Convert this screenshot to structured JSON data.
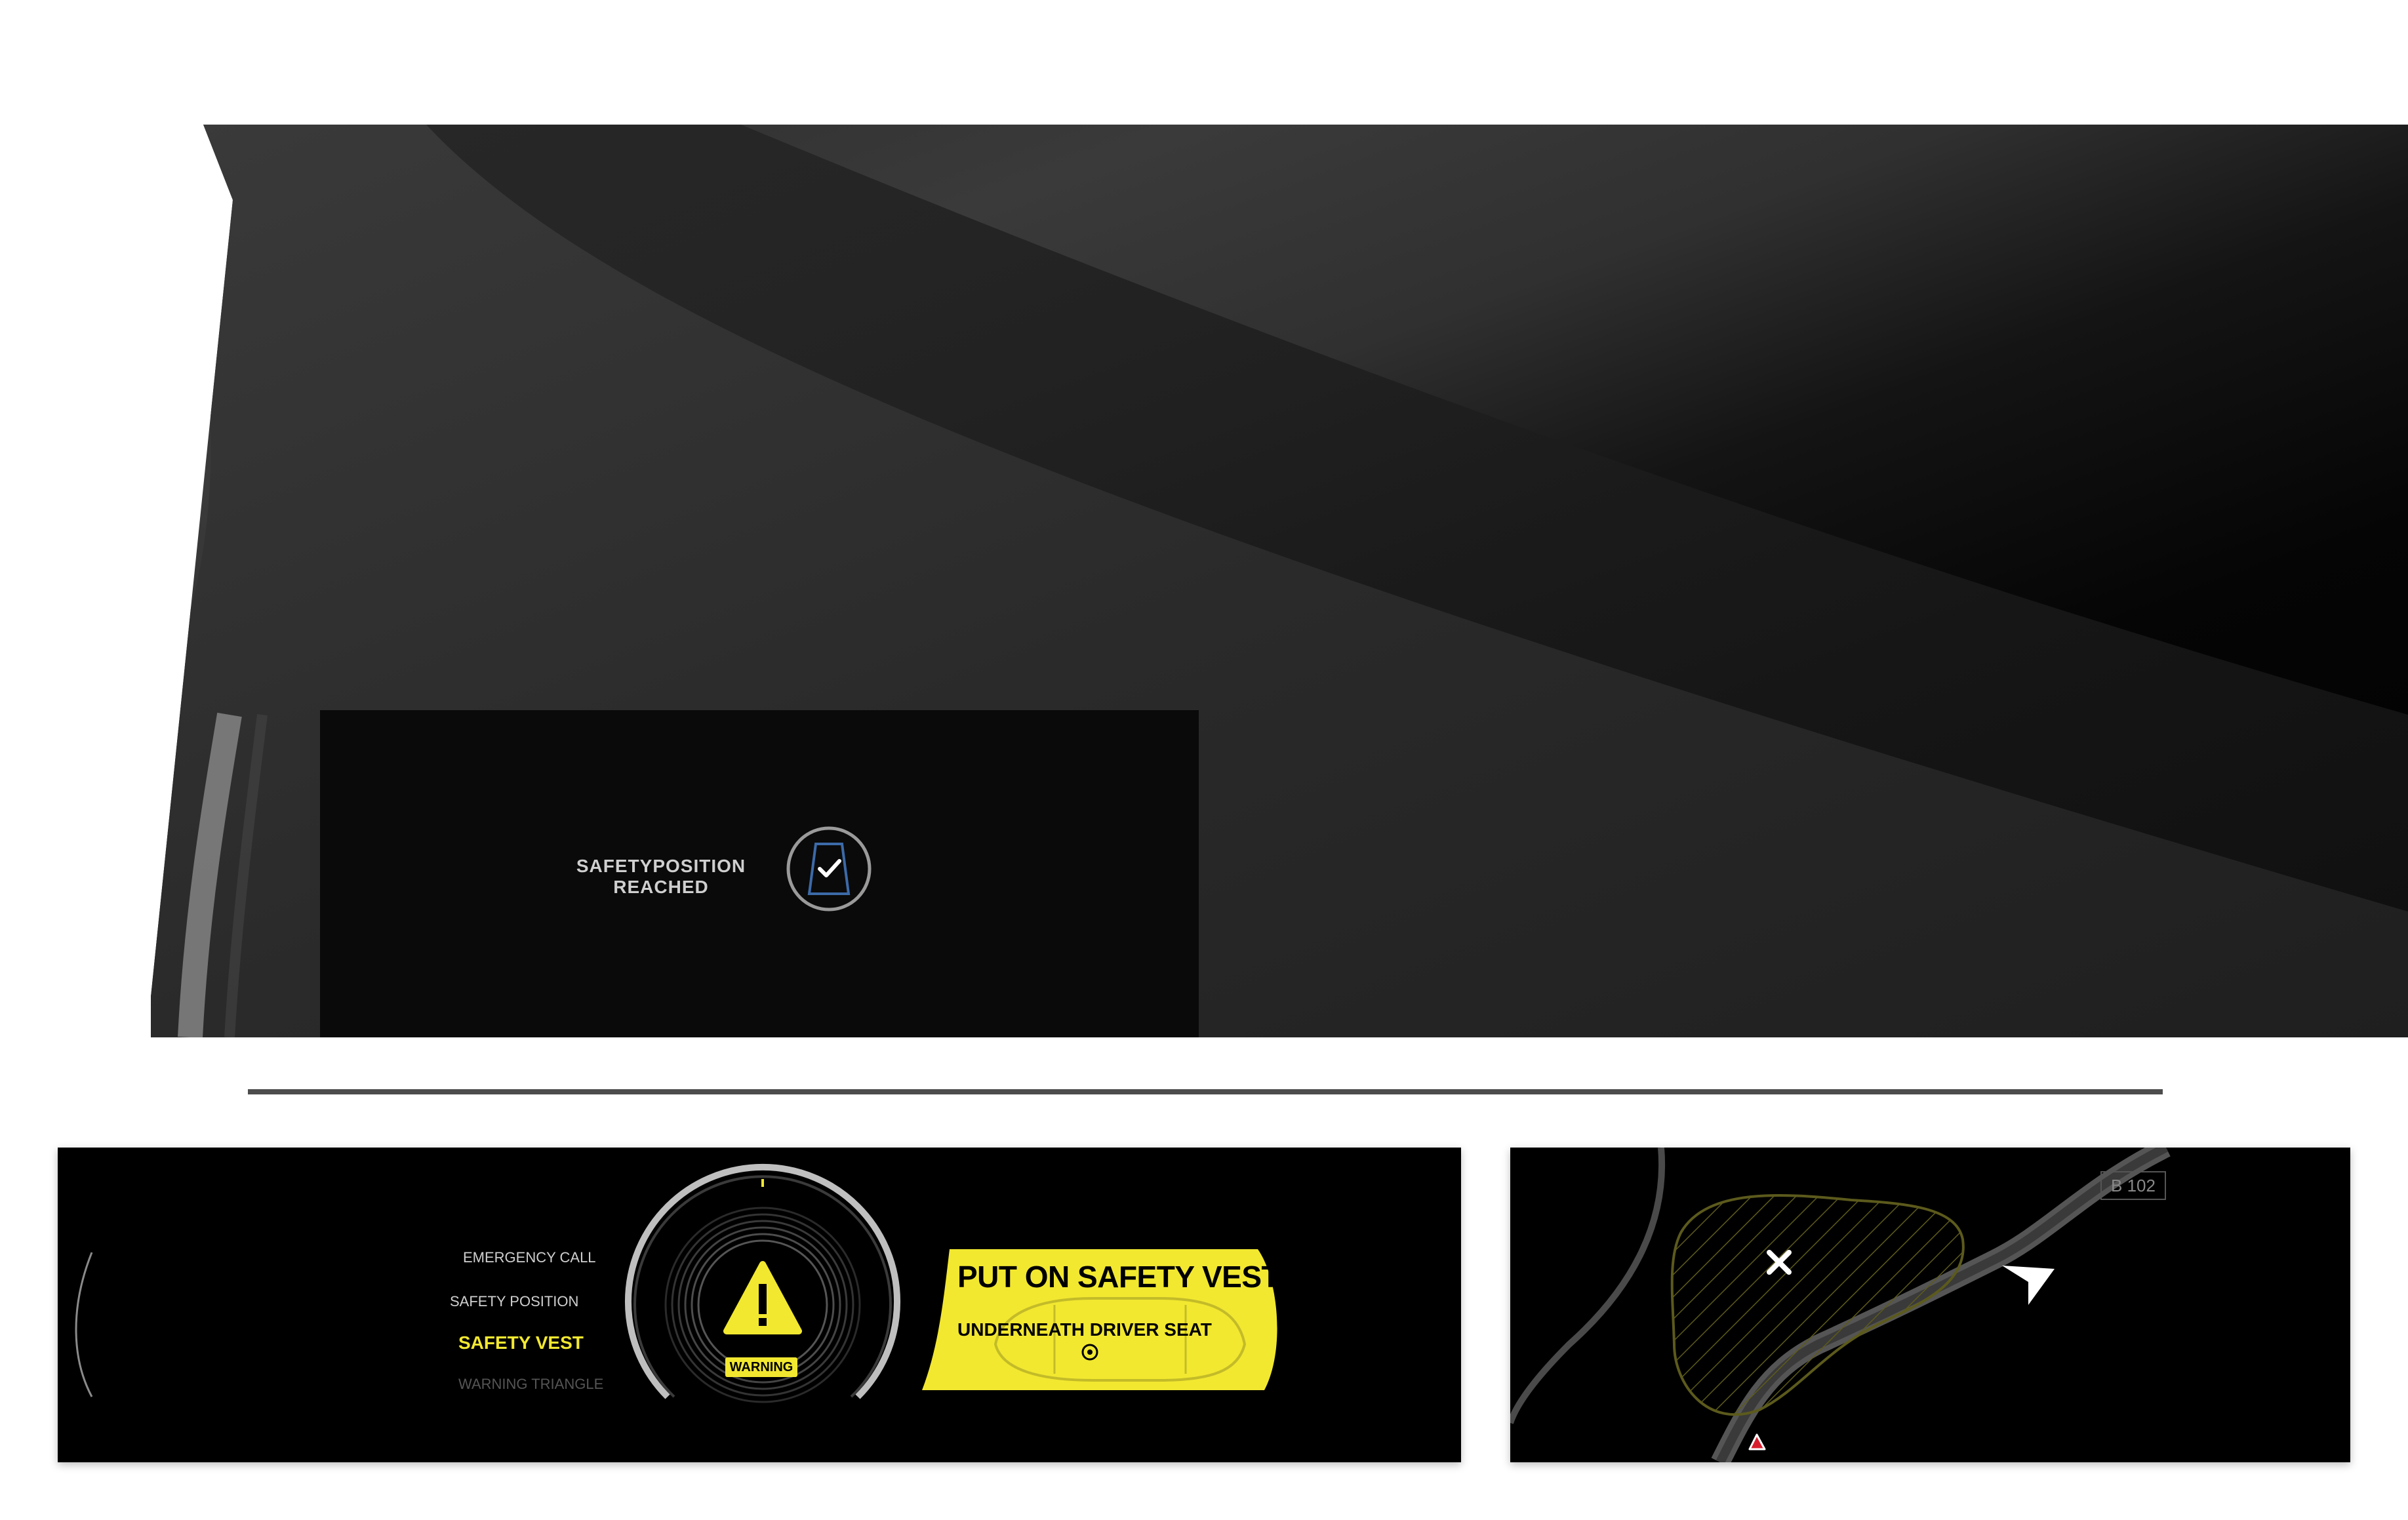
{
  "hero": {
    "safety_status_line1": "SAFETYPOSITION",
    "safety_status_line2": "REACHED",
    "accent_color": "#3c6aa8"
  },
  "cluster": {
    "menu": [
      {
        "label": "EMERGENCY CALL",
        "state": "normal"
      },
      {
        "label": "SAFETY POSITION",
        "state": "normal"
      },
      {
        "label": "SAFETY VEST",
        "state": "active"
      },
      {
        "label": "WARNING TRIANGLE",
        "state": "dim"
      }
    ],
    "warning_label": "WARNING",
    "banner_title": "PUT ON SAFETY VEST",
    "banner_subtitle": "UNDERNEATH DRIVER SEAT",
    "highlight_color": "#f2e830"
  },
  "map": {
    "road_label": "B 102",
    "hazard_color": "#d81e2e"
  }
}
